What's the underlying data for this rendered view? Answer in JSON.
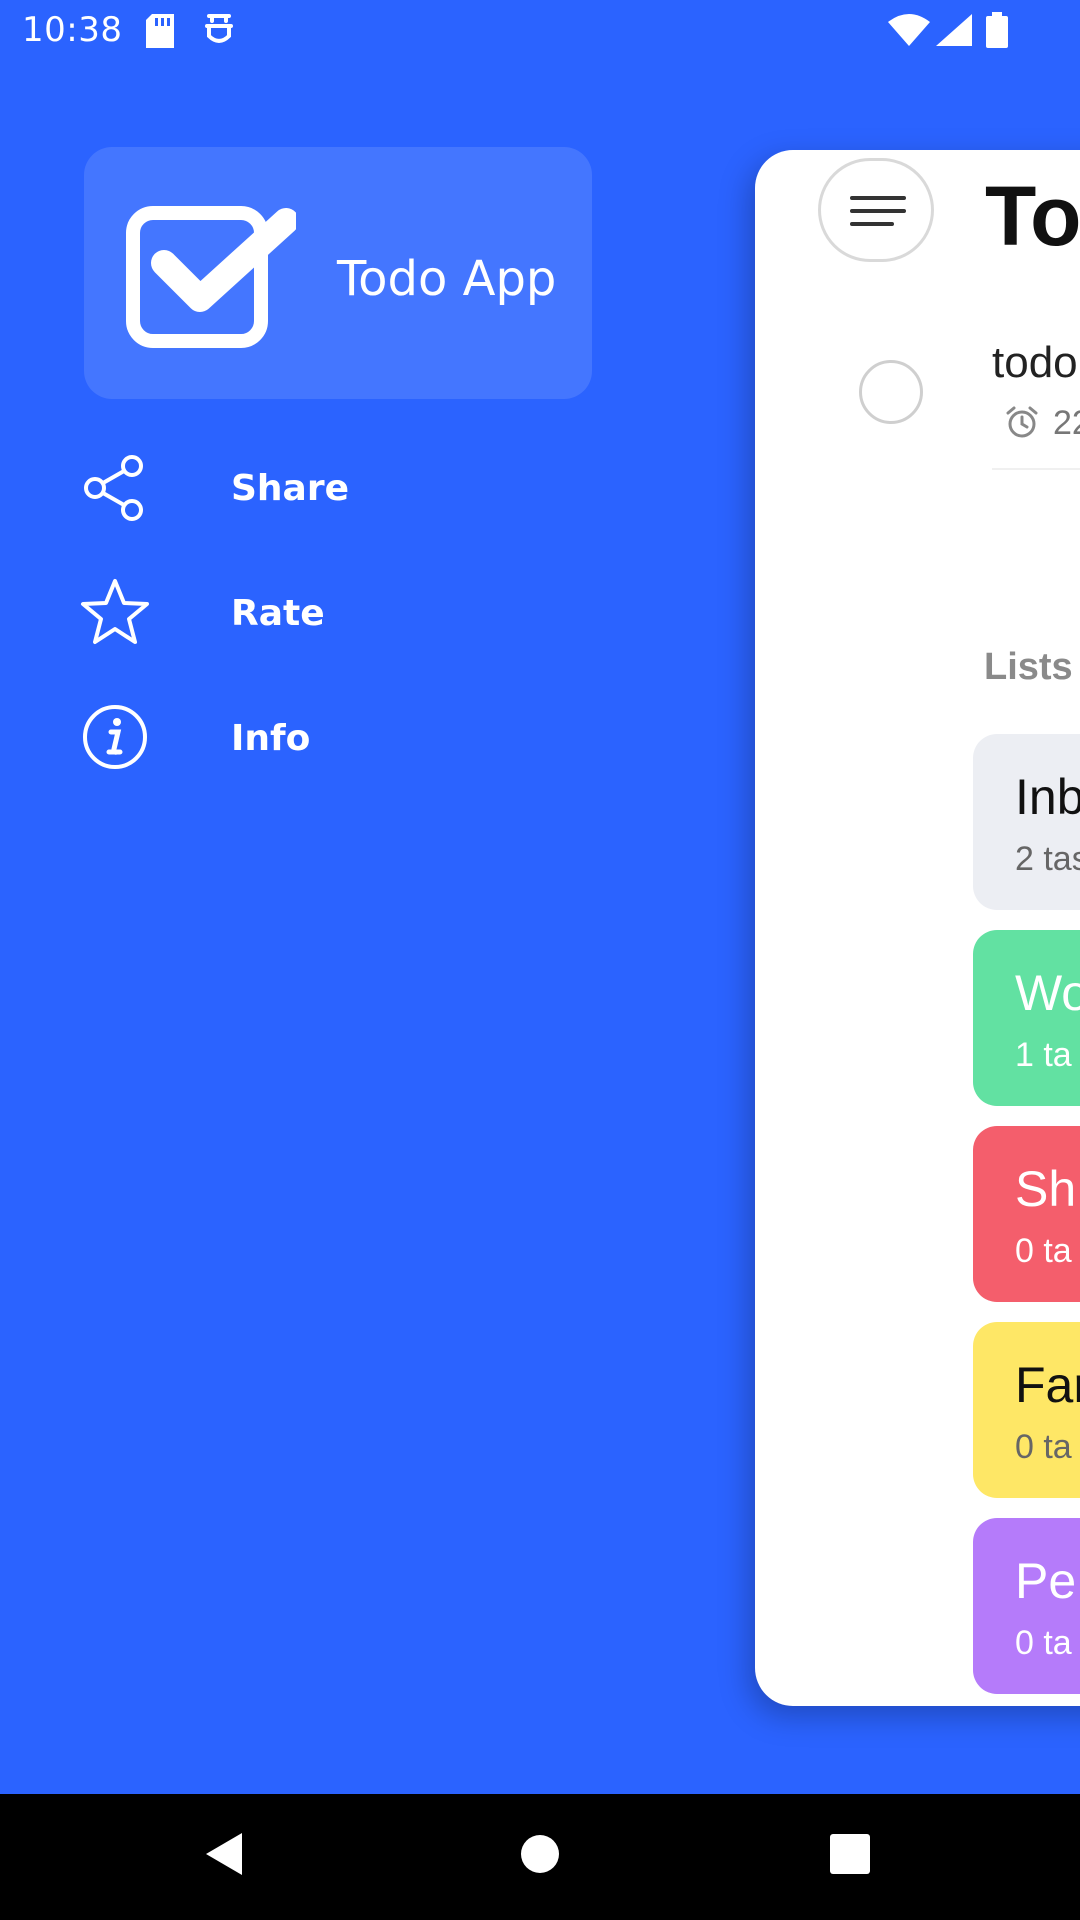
{
  "status_bar": {
    "time": "10:38",
    "icons": [
      "sd-card-icon",
      "tray-icon",
      "wifi-icon",
      "signal-icon",
      "battery-icon"
    ]
  },
  "drawer": {
    "app_title": "Todo App",
    "logo_icon": "checkbox-logo-icon",
    "items": [
      {
        "label": "Share",
        "icon": "share-icon"
      },
      {
        "label": "Rate",
        "icon": "star-icon"
      },
      {
        "label": "Info",
        "icon": "info-icon"
      }
    ]
  },
  "main": {
    "title": "To",
    "menu_icon": "hamburger-menu-icon",
    "todo": {
      "title": "todo",
      "time": "22"
    },
    "lists_heading": "Lists",
    "lists": [
      {
        "name": "Inb",
        "count": "2 tas",
        "bg": "#eceef3",
        "name_color": "#111111",
        "count_color": "#666666"
      },
      {
        "name": "Wo",
        "count": "1 ta",
        "bg": "#62e1a2",
        "name_color": "#ffffff",
        "count_color": "#ffffff"
      },
      {
        "name": "Sh",
        "count": "0 ta",
        "bg": "#f45e6c",
        "name_color": "#ffffff",
        "count_color": "#ffffff"
      },
      {
        "name": "Far",
        "count": "0 ta",
        "bg": "#fee766",
        "name_color": "#111111",
        "count_color": "#666666"
      },
      {
        "name": "Pe",
        "count": "0 ta",
        "bg": "#b57bfa",
        "name_color": "#ffffff",
        "count_color": "#ffffff"
      }
    ]
  },
  "nav_bar": {
    "icons": [
      "back-icon",
      "home-icon",
      "recents-icon"
    ]
  },
  "colors": {
    "drawer_background": "#2b63ff",
    "card_background": "#ffffff"
  }
}
